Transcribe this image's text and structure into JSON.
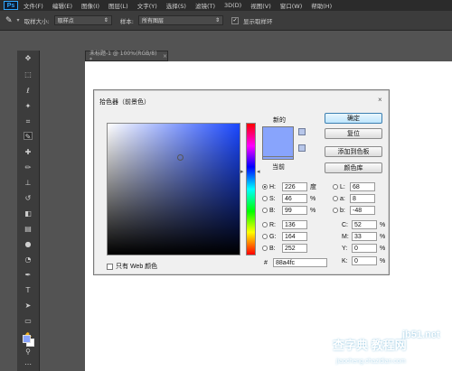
{
  "app": {
    "logo": "Ps"
  },
  "menubar": {
    "items": [
      "文件(F)",
      "编辑(E)",
      "图像(I)",
      "图层(L)",
      "文字(Y)",
      "选择(S)",
      "滤镜(T)",
      "3D(D)",
      "视图(V)",
      "窗口(W)",
      "帮助(H)"
    ]
  },
  "options": {
    "sample_size_label": "取样大小:",
    "sample_size_value": "取样点",
    "sample_label": "样本:",
    "sample_value": "所有图层",
    "show_ring_label": "显示取样环"
  },
  "document": {
    "tab_title": "未标题-1 @ 100%(RGB/8) *"
  },
  "dialog": {
    "title": "拾色器（前景色）",
    "new_label": "新的",
    "current_label": "当前",
    "buttons": {
      "ok": "确定",
      "reset": "复位",
      "add_swatch": "添加到色板",
      "libraries": "颜色库"
    },
    "hsb": [
      {
        "label": "H:",
        "value": "226",
        "unit": "度",
        "selected": true
      },
      {
        "label": "S:",
        "value": "46",
        "unit": "%",
        "selected": false
      },
      {
        "label": "B:",
        "value": "99",
        "unit": "%",
        "selected": false
      }
    ],
    "rgb": [
      {
        "label": "R:",
        "value": "136"
      },
      {
        "label": "G:",
        "value": "164"
      },
      {
        "label": "B:",
        "value": "252"
      }
    ],
    "lab": [
      {
        "label": "L:",
        "value": "68"
      },
      {
        "label": "a:",
        "value": "8"
      },
      {
        "label": "b:",
        "value": "-48"
      }
    ],
    "cmyk": [
      {
        "label": "C:",
        "value": "52",
        "unit": "%"
      },
      {
        "label": "M:",
        "value": "33",
        "unit": "%"
      },
      {
        "label": "Y:",
        "value": "0",
        "unit": "%"
      },
      {
        "label": "K:",
        "value": "0",
        "unit": "%"
      }
    ],
    "hex_label": "#",
    "hex_value": "88a4fc",
    "web_only_label": "只有 Web 颜色"
  },
  "colors": {
    "picked": "#88a4fc",
    "pure_hue": "#1a47ff"
  },
  "watermark": {
    "brand": "查字典 教程网",
    "site": "jb51.net",
    "url": "jiaocheng.chazidian.com"
  }
}
